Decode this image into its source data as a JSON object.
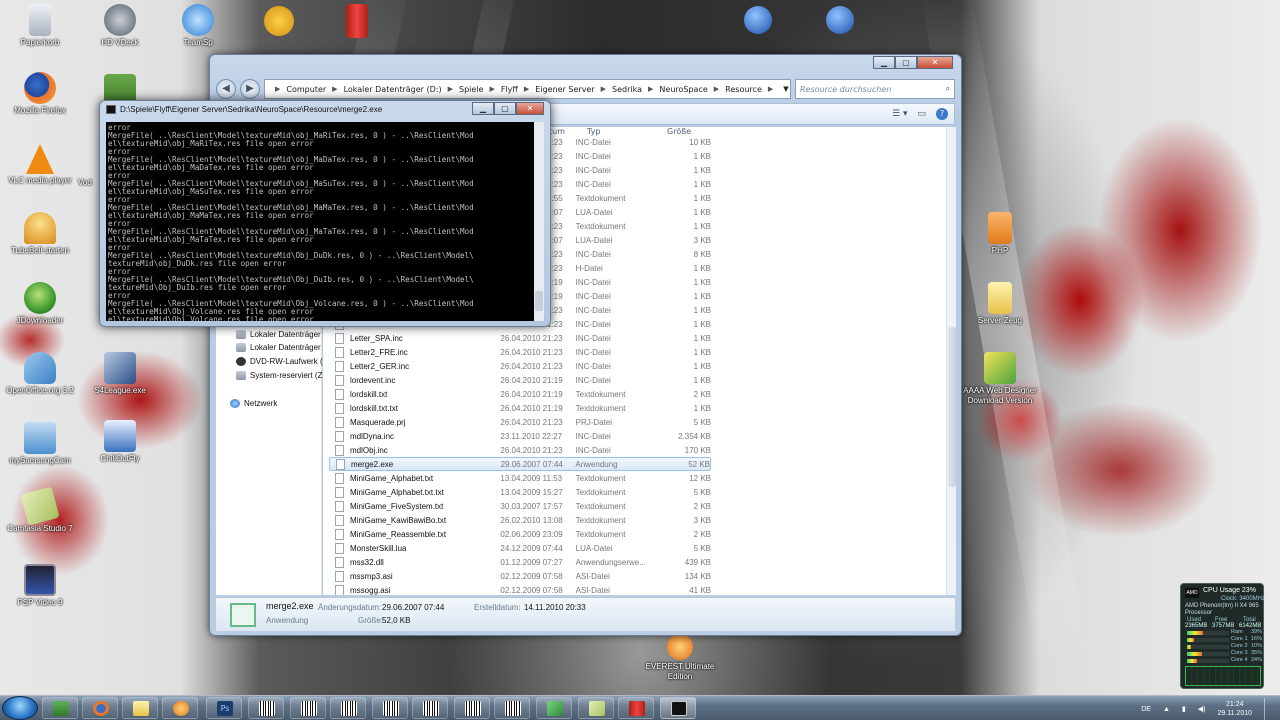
{
  "desktop": {
    "icons_left": [
      {
        "label": "Papierkorb",
        "icon": "recycle-bin-icon",
        "color": "#c7d0da"
      },
      {
        "label": "Mozilla Firefox",
        "icon": "firefox-icon",
        "color": "#e8762b"
      },
      {
        "label": "VLC media player",
        "icon": "vlc-icon",
        "color": "#f08a10"
      },
      {
        "label": "TubeBell starten",
        "icon": "tubebell-icon",
        "color": "#e1a030"
      },
      {
        "label": "JDownloader",
        "icon": "jdownloader-icon",
        "color": "#3f9a2e"
      },
      {
        "label": "OpenOffice.org 3.2",
        "icon": "openoffice-icon",
        "color": "#3c7fc4"
      },
      {
        "label": "mySamsungCam",
        "icon": "camera-icon",
        "color": "#4b8fd0"
      },
      {
        "label": "Camtasia Studio 7",
        "icon": "camtasia-icon",
        "color": "#a8c060"
      },
      {
        "label": "PSP Video 9",
        "icon": "psp-video-icon",
        "color": "#3355aa"
      }
    ],
    "icons_col2": [
      {
        "label": "HD VDeck",
        "icon": "hdvdeck-icon",
        "color": "#555c66"
      },
      {
        "label": "Vod",
        "icon": "vod-icon",
        "color": "#3f7c2c"
      },
      {
        "label": "S4League.exe",
        "icon": "s4league-icon",
        "color": "#2b4f8a"
      },
      {
        "label": "ChillOutFly",
        "icon": "chilloutfly-icon",
        "color": "#3a6fc0"
      }
    ],
    "icons_top": [
      {
        "label": "TeamSp",
        "icon": "teamspeak-icon",
        "color": "#2b7fd6"
      }
    ],
    "icons_right": [
      {
        "label": "PHP",
        "icon": "php-icon",
        "color": "#e07a1c"
      },
      {
        "label": "Server Zeug",
        "icon": "folder-icon",
        "color": "#e6c24a"
      },
      {
        "label": "AAAA Web Designer Download Version",
        "icon": "web-designer-icon",
        "color": "#4aa33a"
      },
      {
        "label": "EVEREST Ultimate Edition",
        "icon": "everest-icon",
        "color": "#e06a14"
      }
    ]
  },
  "explorer": {
    "breadcrumb": [
      "Computer",
      "Lokaler Datenträger (D:)",
      "Spiele",
      "Flyff",
      "Eigener Server",
      "Sedrika",
      "NeuroSpace",
      "Resource"
    ],
    "search_placeholder": "Resource durchsuchen",
    "columns": {
      "date": "Änderungsdatum",
      "date_visible": "tum",
      "type": "Typ",
      "size": "Größe"
    },
    "nav_items": [
      "Lokaler Datenträger",
      "Lokaler Datenträger",
      "DVD-RW-Laufwerk (",
      "System-reserviert (Z",
      "Netzwerk"
    ],
    "files_hidden": [
      {
        "type": "INC-Datei",
        "size": "10 KB",
        "date": "26.04.2010 21:23"
      },
      {
        "type": "INC-Datei",
        "size": "1 KB",
        "date": "26.04.2010 21:23"
      },
      {
        "type": "INC-Datei",
        "size": "1 KB",
        "date": "26.04.2010 21:23"
      },
      {
        "type": "INC-Datei",
        "size": "1 KB",
        "date": "26.04.2010 21:23"
      },
      {
        "type": "Textdokument",
        "size": "1 KB",
        "date": "26.04.2010 21:55"
      },
      {
        "type": "LUA-Datei",
        "size": "1 KB",
        "date": "26.04.2010 21:07"
      },
      {
        "type": "Textdokument",
        "size": "1 KB",
        "date": "26.04.2010 21:23"
      },
      {
        "type": "LUA-Datei",
        "size": "3 KB",
        "date": "26.04.2010 21:07"
      },
      {
        "type": "INC-Datei",
        "size": "8 KB",
        "date": "26.04.2010 21:23"
      },
      {
        "type": "H-Datei",
        "size": "1 KB",
        "date": "26.04.2010 21:23"
      },
      {
        "type": "INC-Datei",
        "size": "1 KB",
        "date": "26.04.2010 21:19"
      },
      {
        "type": "INC-Datei",
        "size": "1 KB",
        "date": "26.04.2010 21:19"
      },
      {
        "type": "INC-Datei",
        "size": "1 KB",
        "date": "26.04.2010 21:23"
      },
      {
        "type": "INC-Datei",
        "size": "1 KB",
        "date": "26.04.2010 21:23"
      }
    ],
    "files": [
      {
        "name": "Letter_SPA.inc",
        "date": "26.04.2010 21:23",
        "type": "INC-Datei",
        "size": "1 KB"
      },
      {
        "name": "Letter2_FRE.inc",
        "date": "26.04.2010 21:23",
        "type": "INC-Datei",
        "size": "1 KB"
      },
      {
        "name": "Letter2_GER.inc",
        "date": "26.04.2010 21:23",
        "type": "INC-Datei",
        "size": "1 KB"
      },
      {
        "name": "lordevent.inc",
        "date": "26.04.2010 21:19",
        "type": "INC-Datei",
        "size": "1 KB"
      },
      {
        "name": "lordskill.txt",
        "date": "26.04.2010 21:19",
        "type": "Textdokument",
        "size": "2 KB"
      },
      {
        "name": "lordskill.txt.txt",
        "date": "26.04.2010 21:19",
        "type": "Textdokument",
        "size": "1 KB"
      },
      {
        "name": "Masquerade.prj",
        "date": "26.04.2010 21:23",
        "type": "PRJ-Datei",
        "size": "5 KB"
      },
      {
        "name": "mdlDyna.inc",
        "date": "23.11.2010 22:27",
        "type": "INC-Datei",
        "size": "2.354 KB"
      },
      {
        "name": "mdlObj.inc",
        "date": "26.04.2010 21:23",
        "type": "INC-Datei",
        "size": "170 KB"
      },
      {
        "name": "merge2.exe",
        "date": "29.06.2007 07:44",
        "type": "Anwendung",
        "size": "52 KB",
        "selected": true
      },
      {
        "name": "MiniGame_Alphabet.txt",
        "date": "13.04.2009 11:53",
        "type": "Textdokument",
        "size": "12 KB"
      },
      {
        "name": "MiniGame_Alphabet.txt.txt",
        "date": "13.04.2009 15:27",
        "type": "Textdokument",
        "size": "5 KB"
      },
      {
        "name": "MiniGame_FiveSystem.txt",
        "date": "30.03.2007 17:57",
        "type": "Textdokument",
        "size": "2 KB"
      },
      {
        "name": "MiniGame_KawiBawiBo.txt",
        "date": "26.02.2010 13:08",
        "type": "Textdokument",
        "size": "3 KB"
      },
      {
        "name": "MiniGame_Reassemble.txt",
        "date": "02.06.2009 23:09",
        "type": "Textdokument",
        "size": "2 KB"
      },
      {
        "name": "MonsterSkill.lua",
        "date": "24.12.2009 07:44",
        "type": "LUA-Datei",
        "size": "5 KB"
      },
      {
        "name": "mss32.dll",
        "date": "01.12.2009 07:27",
        "type": "Anwendungserwe...",
        "size": "439 KB"
      },
      {
        "name": "mssmp3.asi",
        "date": "02.12.2009 07:58",
        "type": "ASI-Datei",
        "size": "134 KB"
      },
      {
        "name": "mssogg.asi",
        "date": "02.12.2009 07:58",
        "type": "ASI-Datei",
        "size": "41 KB"
      }
    ],
    "details": {
      "name": "merge2.exe",
      "modified_label": "Änderungsdatum:",
      "modified_value": "29.06.2007 07:44",
      "created_label": "Erstelldatum:",
      "created_value": "14.11.2010 20:33",
      "type": "Anwendung",
      "size_label": "Größe:",
      "size_value": "52,0 KB"
    }
  },
  "console": {
    "title": "D:\\Spiele\\Flyff\\Eigener Server\\Sedrika\\NeuroSpace\\Resource\\merge2.exe",
    "lines": [
      "error",
      "MergeFile( ..\\ResClient\\Model\\textureMid\\obj_MaRiTex.res, 0 ) - ..\\ResClient\\Mod",
      "el\\textureMid\\obj_MaRiTex.res file open error",
      "error",
      "MergeFile( ..\\ResClient\\Model\\textureMid\\obj_MaDaTex.res, 0 ) - ..\\ResClient\\Mod",
      "el\\textureMid\\obj_MaDaTex.res file open error",
      "error",
      "MergeFile( ..\\ResClient\\Model\\textureMid\\obj_MaSuTex.res, 0 ) - ..\\ResClient\\Mod",
      "el\\textureMid\\obj_MaSuTex.res file open error",
      "error",
      "MergeFile( ..\\ResClient\\Model\\textureMid\\obj_MaMaTex.res, 0 ) - ..\\ResClient\\Mod",
      "el\\textureMid\\obj_MaMaTex.res file open error",
      "error",
      "MergeFile( ..\\ResClient\\Model\\textureMid\\obj_MaTaTex.res, 0 ) - ..\\ResClient\\Mod",
      "el\\textureMid\\obj_MaTaTex.res file open error",
      "error",
      "MergeFile( ..\\ResClient\\Model\\textureMid\\Obj_DuDk.res, 0 ) - ..\\ResClient\\Model\\",
      "textureMid\\obj_DuDk.res file open error",
      "error",
      "MergeFile( ..\\ResClient\\Model\\textureMid\\Obj_DuIb.res, 0 ) - ..\\ResClient\\Model\\",
      "textureMid\\Obj_DuIb.res file open error",
      "error",
      "MergeFile( ..\\ResClient\\Model\\textureMid\\Obj_Volcane.res, 0 ) - ..\\ResClient\\Mod",
      "el\\textureMid\\Obj_Volcane.res file open error",
      "el\\textureMid\\Obj_Volcane.res file open error"
    ]
  },
  "gadget": {
    "title": "CPU Usage 23%",
    "clock": "Clock: 3400MHz",
    "cpu": "AMD Phenom(tm) II X4 965",
    "processor": "Processor",
    "mem_headers": [
      "Used",
      "Free",
      "Total"
    ],
    "mem_values": [
      "2365MB",
      "3757MB",
      "6142MB"
    ],
    "cores": [
      {
        "label": "Ram",
        "pct": "39%",
        "value": 0.39
      },
      {
        "label": "Core 1",
        "pct": "16%",
        "value": 0.16
      },
      {
        "label": "Core 2",
        "pct": "10%",
        "value": 0.1
      },
      {
        "label": "Core 3",
        "pct": "35%",
        "value": 0.35
      },
      {
        "label": "Core 4",
        "pct": "24%",
        "value": 0.24
      }
    ]
  },
  "taskbar": {
    "language": "DE",
    "time": "21:24",
    "date": "29.11.2010"
  }
}
